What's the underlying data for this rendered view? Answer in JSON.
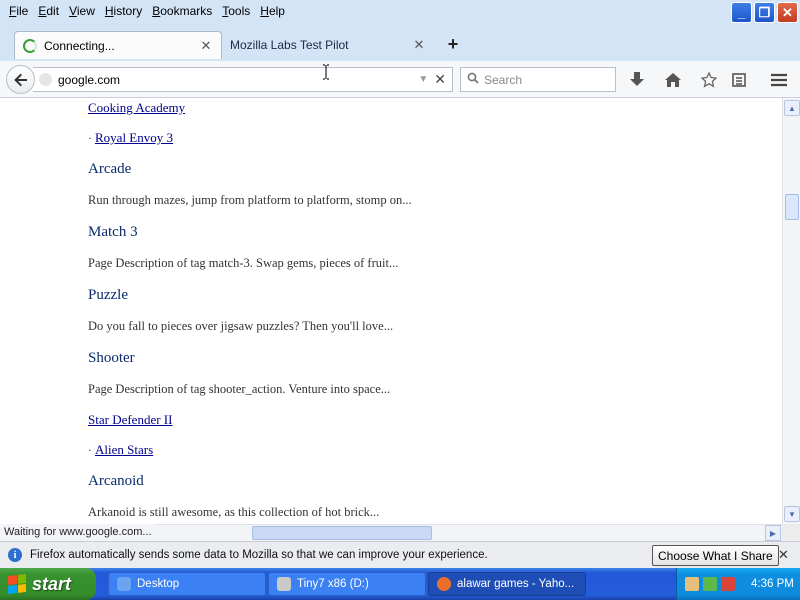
{
  "menubar": {
    "items": [
      {
        "ul": "F",
        "rest": "ile"
      },
      {
        "ul": "E",
        "rest": "dit"
      },
      {
        "ul": "V",
        "rest": "iew"
      },
      {
        "ul": "H",
        "rest": "istory"
      },
      {
        "ul": "B",
        "rest": "ookmarks"
      },
      {
        "ul": "T",
        "rest": "ools"
      },
      {
        "ul": "H",
        "rest": "elp"
      }
    ]
  },
  "tabs": [
    {
      "label": "Connecting...",
      "state": "loading"
    },
    {
      "label": "Mozilla Labs Test Pilot"
    }
  ],
  "navbar": {
    "url": "google.com",
    "search_placeholder": "Search"
  },
  "content": {
    "lines": [
      {
        "type": "link",
        "text": "Cooking Academy"
      },
      {
        "type": "bullet-link",
        "text": "Royal Envoy 3"
      },
      {
        "type": "heading",
        "text": "Arcade"
      },
      {
        "type": "desc",
        "text": "Run through mazes, jump from platform to platform, stomp on..."
      },
      {
        "type": "heading",
        "text": "Match 3"
      },
      {
        "type": "desc",
        "text": "Page Description of tag match-3. Swap gems, pieces of fruit..."
      },
      {
        "type": "heading",
        "text": "Puzzle"
      },
      {
        "type": "desc",
        "text": "Do you fall to pieces over jigsaw puzzles? Then you'll love..."
      },
      {
        "type": "heading",
        "text": "Shooter"
      },
      {
        "type": "desc",
        "text": "Page Description of tag shooter_action. Venture into space..."
      },
      {
        "type": "link",
        "text": "Star Defender II"
      },
      {
        "type": "bullet-link",
        "text": "Alien Stars"
      },
      {
        "type": "heading",
        "text": "Arcanoid"
      },
      {
        "type": "desc",
        "text": "Arkanoid is still awesome, as this collection of hot brick..."
      }
    ]
  },
  "status": {
    "text": "Waiting for www.google.com..."
  },
  "notification": {
    "text": "Firefox automatically sends some data to Mozilla so that we can improve your experience.",
    "button": "Choose What I Share"
  },
  "taskbar": {
    "start": "start",
    "tasks": [
      {
        "label": "Desktop"
      },
      {
        "label": "Tiny7 x86 (D:)"
      },
      {
        "label": "alawar games - Yaho..."
      }
    ],
    "clock": "4:36 PM"
  },
  "colors": {
    "link": "#00008b",
    "heading": "#0a2a6a",
    "chrome": "#d4e4f7",
    "taskbar": "#245ddb",
    "start": "#338c2a"
  }
}
